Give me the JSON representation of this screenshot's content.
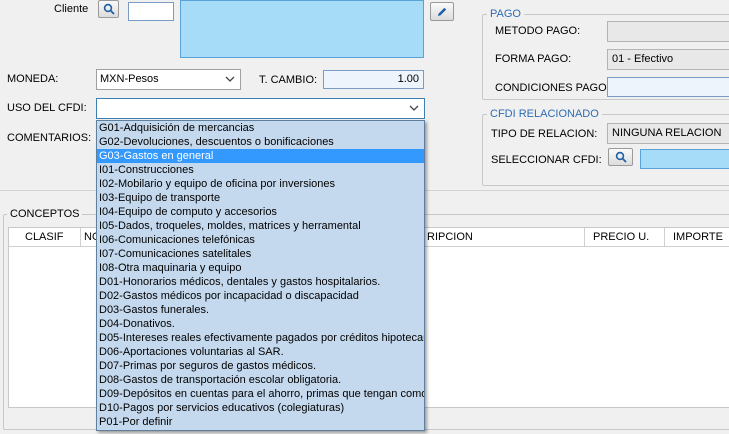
{
  "client": {
    "label": "Cliente"
  },
  "currency": {
    "label": "MONEDA:",
    "value": "MXN-Pesos"
  },
  "exchange": {
    "label": "T. CAMBIO:",
    "value": "1.00"
  },
  "cfdi_use": {
    "label": "USO DEL CFDI:",
    "value": ""
  },
  "comments": {
    "label": "COMENTARIOS:"
  },
  "payment": {
    "title": "PAGO",
    "method_label": "METODO PAGO:",
    "method_value": "",
    "form_label": "FORMA PAGO:",
    "form_value": "01 - Efectivo",
    "conditions_label": "CONDICIONES PAGO:",
    "conditions_value": ""
  },
  "related": {
    "title": "CFDI RELACIONADO",
    "type_label": "TIPO DE RELACION:",
    "type_value": "NINGUNA RELACION",
    "select_label": "SELECCIONAR CFDI:"
  },
  "concepts": {
    "title": "CONCEPTOS",
    "columns": [
      "CLASIF",
      "NO",
      "RIPCION",
      "PRECIO U.",
      "IMPORTE"
    ]
  },
  "dropdown": {
    "selected_index": 2,
    "options": [
      "G01-Adquisición de mercancias",
      "G02-Devoluciones, descuentos o bonificaciones",
      "G03-Gastos en general",
      "I01-Construcciones",
      "I02-Mobilario y equipo de oficina por inversiones",
      "I03-Equipo de transporte",
      "I04-Equipo de computo y accesorios",
      "I05-Dados, troqueles, moldes, matrices y herramental",
      "I06-Comunicaciones telefónicas",
      "I07-Comunicaciones satelitales",
      "I08-Otra maquinaria y equipo",
      "D01-Honorarios médicos, dentales y gastos hospitalarios.",
      "D02-Gastos médicos por incapacidad o discapacidad",
      "D03-Gastos funerales.",
      "D04-Donativos.",
      "D05-Intereses reales efectivamente pagados por créditos hipotecar",
      "D06-Aportaciones voluntarias al SAR.",
      "D07-Primas por seguros de gastos médicos.",
      "D08-Gastos de transportación escolar obligatoria.",
      "D09-Depósitos en cuentas para el ahorro, primas que tengan como",
      "D10-Pagos por servicios educativos (colegiaturas)",
      "P01-Por definir"
    ]
  }
}
